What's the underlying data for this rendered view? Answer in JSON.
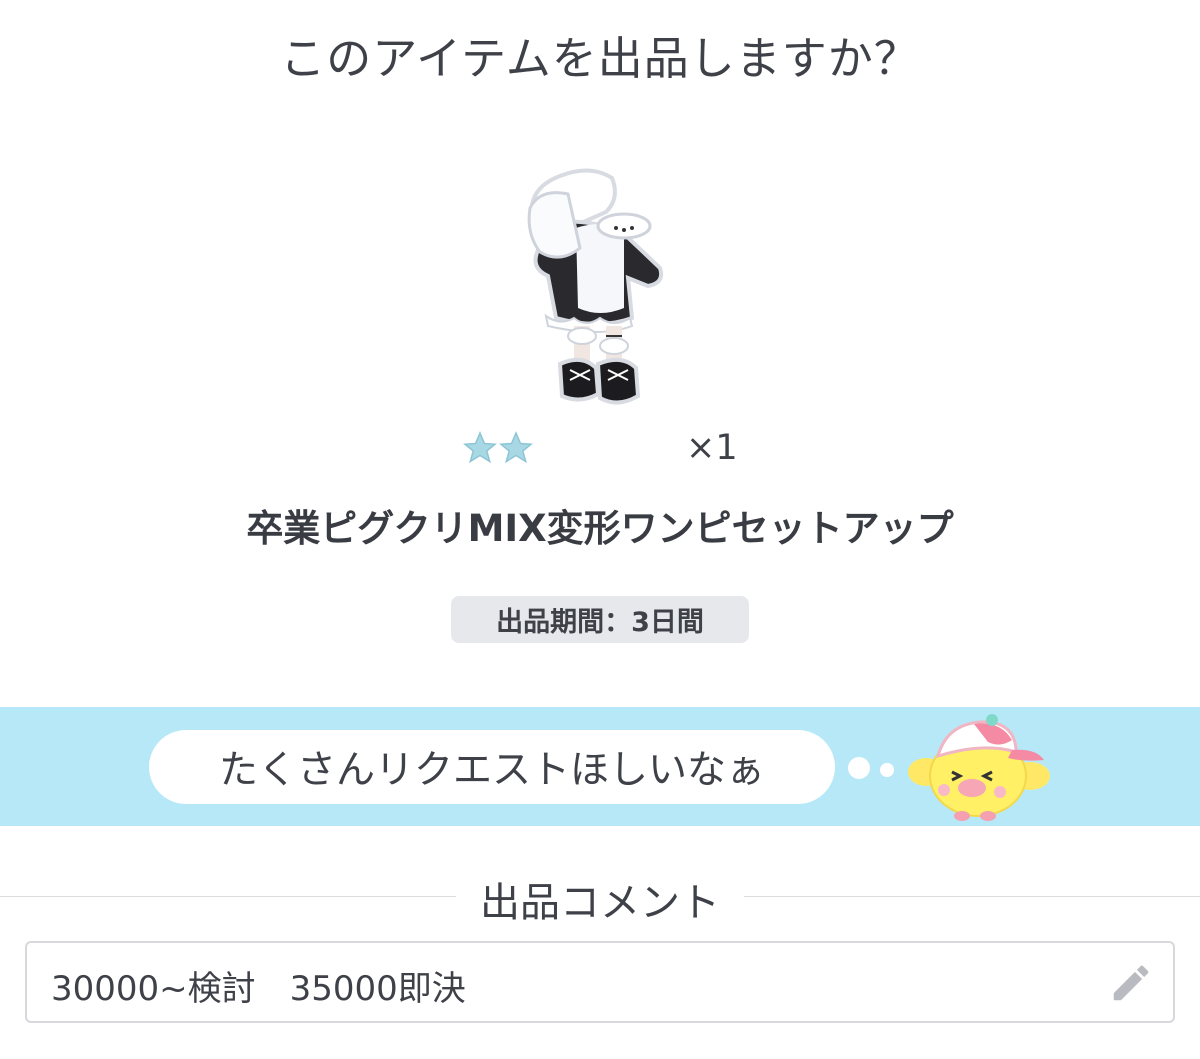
{
  "dialog": {
    "title": "このアイテムを出品しますか？"
  },
  "item": {
    "image_icon": "outfit-image",
    "rarity_stars": 2,
    "quantity_label": "×1",
    "name": "卒業ピグクリMIX変形ワンピセットアップ",
    "period_label": "出品期間：3日間"
  },
  "request": {
    "message": "たくさんリクエストほしいなぁ",
    "mascot_icon": "chick-mascot-icon"
  },
  "comment": {
    "heading": "出品コメント",
    "value": "30000~検討　35000即決",
    "edit_icon": "pencil-icon"
  },
  "colors": {
    "band": "#b7e8f8",
    "period_bg": "#e6e8ec",
    "star": "#a8d8e4"
  }
}
